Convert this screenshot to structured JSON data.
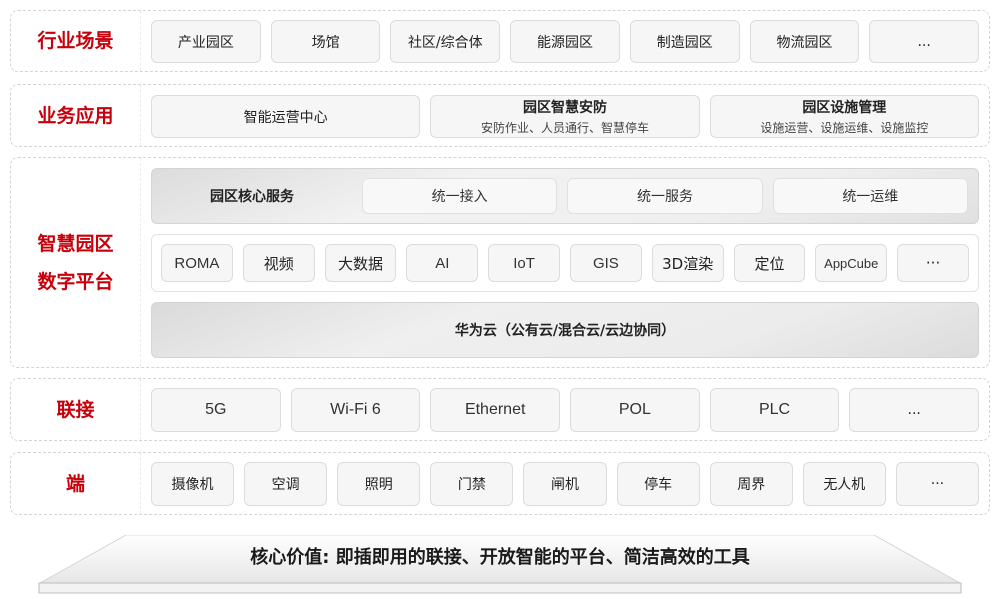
{
  "layers": {
    "scenarios": {
      "label": [
        "行业场景"
      ],
      "items": [
        "产业园区",
        "场馆",
        "社区/综合体",
        "能源园区",
        "制造园区",
        "物流园区",
        "..."
      ]
    },
    "applications": {
      "label": [
        "业务应用"
      ],
      "items": [
        {
          "title": "智能运营中心",
          "subtitle": ""
        },
        {
          "title": "园区智慧安防",
          "subtitle": "安防作业、人员通行、智慧停车"
        },
        {
          "title": "园区设施管理",
          "subtitle": "设施运营、设施运维、设施监控"
        }
      ]
    },
    "platform": {
      "label": [
        "智慧园区",
        "数字平台"
      ],
      "core_title": "园区核心服务",
      "core_items": [
        "统一接入",
        "统一服务",
        "统一运维"
      ],
      "tech_items": [
        "ROMA",
        "视频",
        "大数据",
        "AI",
        "IoT",
        "GIS",
        "3D渲染",
        "定位",
        "AppCube",
        "···"
      ],
      "cloud": "华为云（公有云/混合云/云边协同）"
    },
    "connectivity": {
      "label": [
        "联接"
      ],
      "items": [
        "5G",
        "Wi-Fi 6",
        "Ethernet",
        "POL",
        "PLC",
        "..."
      ]
    },
    "devices": {
      "label": [
        "端"
      ],
      "items": [
        "摄像机",
        "空调",
        "照明",
        "门禁",
        "闸机",
        "停车",
        "周界",
        "无人机",
        "···"
      ]
    }
  },
  "core_value": "核心价值: 即插即用的联接、开放智能的平台、简洁高效的工具",
  "colors": {
    "label_red": "#c7000b",
    "box_bg": "#f6f6f6",
    "box_border": "#dcdcdc"
  }
}
